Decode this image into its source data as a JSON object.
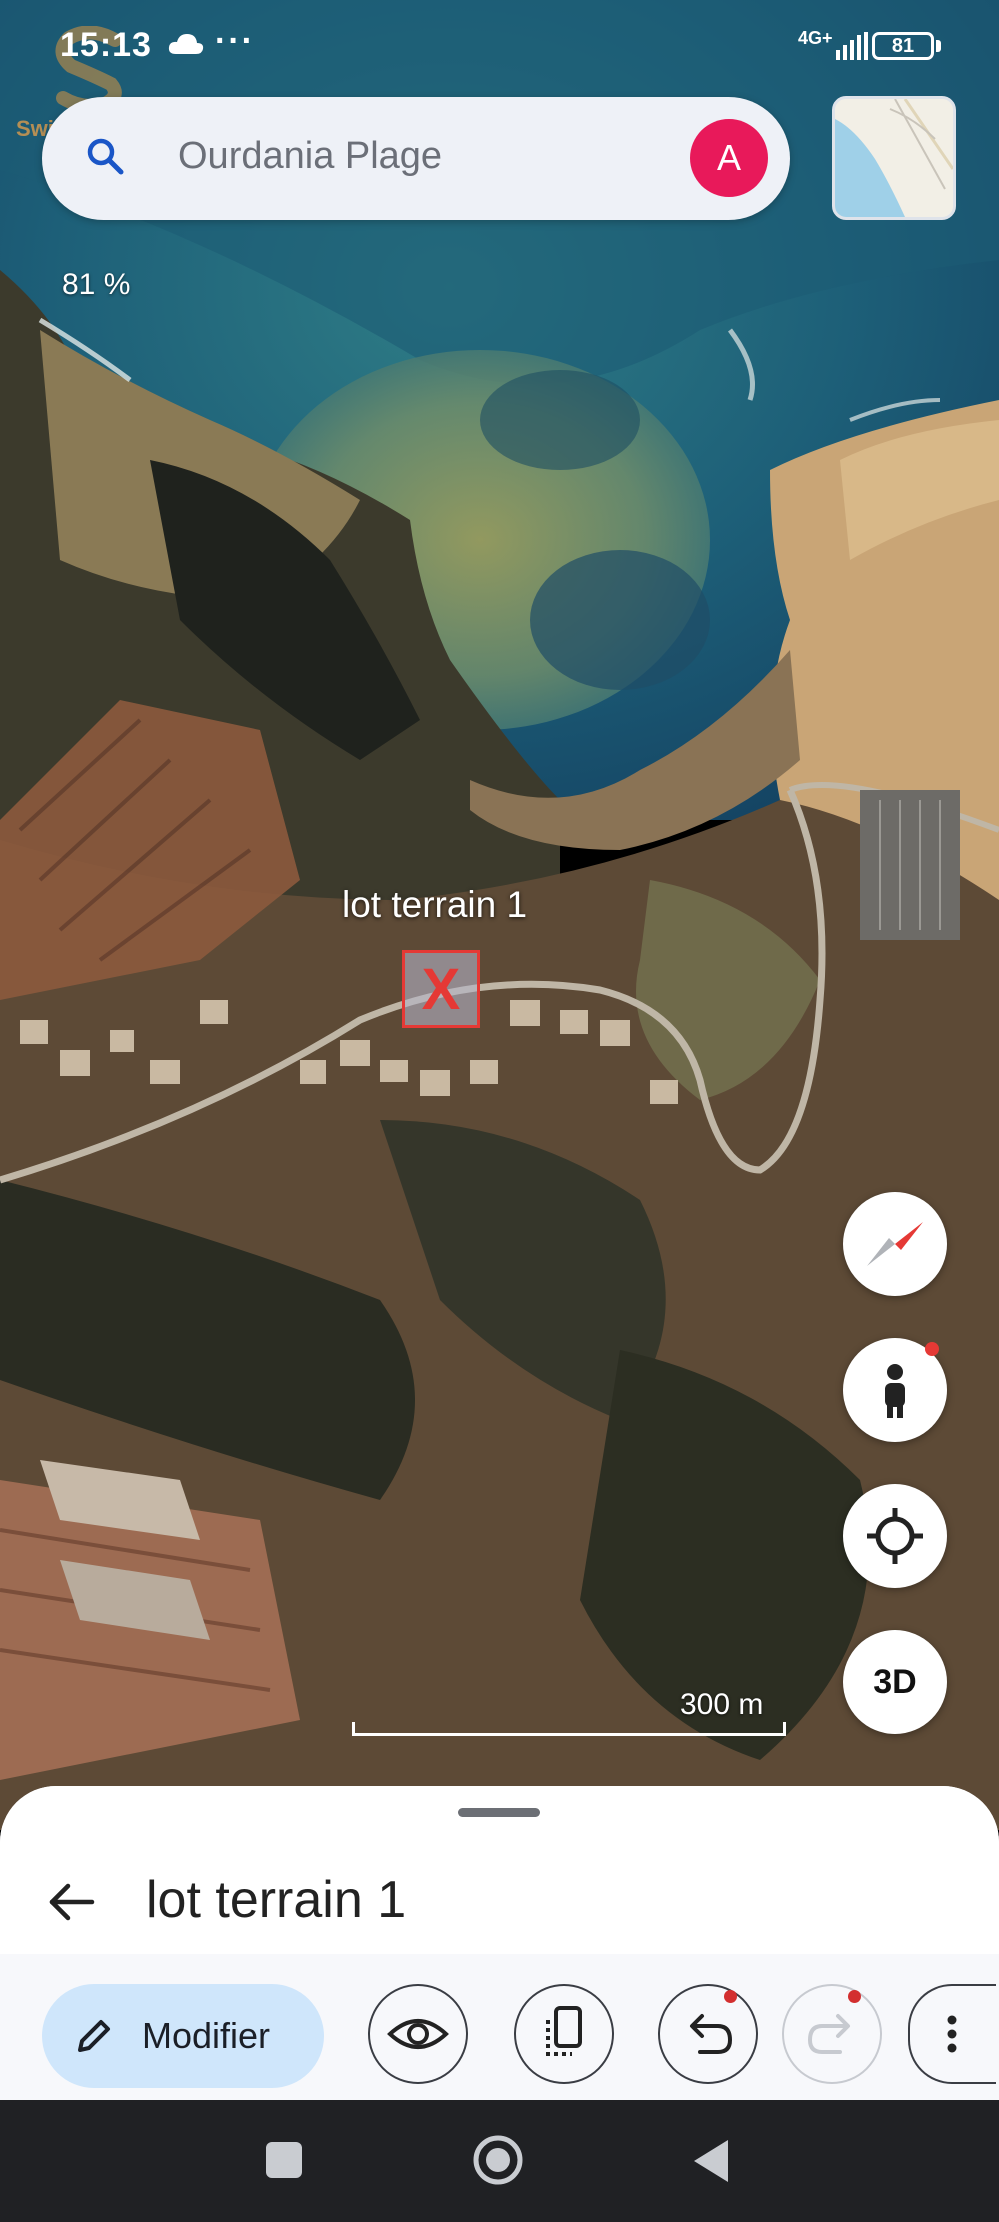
{
  "status_bar": {
    "time": "15:13",
    "more_indicator": "···",
    "network": "4G+",
    "battery": "81",
    "icons": [
      "cloud-icon",
      "signal-icon",
      "battery-icon"
    ]
  },
  "watermark": {
    "text": "Swiga | سويقة"
  },
  "search": {
    "query": "Ourdania Plage",
    "account_initial": "A",
    "account_color": "#e8195a"
  },
  "map": {
    "zoom_readout": "81 %",
    "marker_label": "lot terrain 1",
    "marker_symbol": "X",
    "marker_color": "#e53935",
    "scale_label": "300 m"
  },
  "controls": {
    "compass": "compass-icon",
    "street_view": "pegman-icon",
    "locate": "my-location-icon",
    "view_3d": "3D"
  },
  "sheet": {
    "title": "lot terrain 1",
    "edit_label": "Modifier",
    "edit_color": "#cfe6fb",
    "tools": [
      "eye-icon",
      "copy-icon",
      "undo-icon",
      "redo-icon",
      "more-vert-icon"
    ]
  },
  "nav": {
    "buttons": [
      "recents-icon",
      "home-icon",
      "back-icon"
    ]
  }
}
